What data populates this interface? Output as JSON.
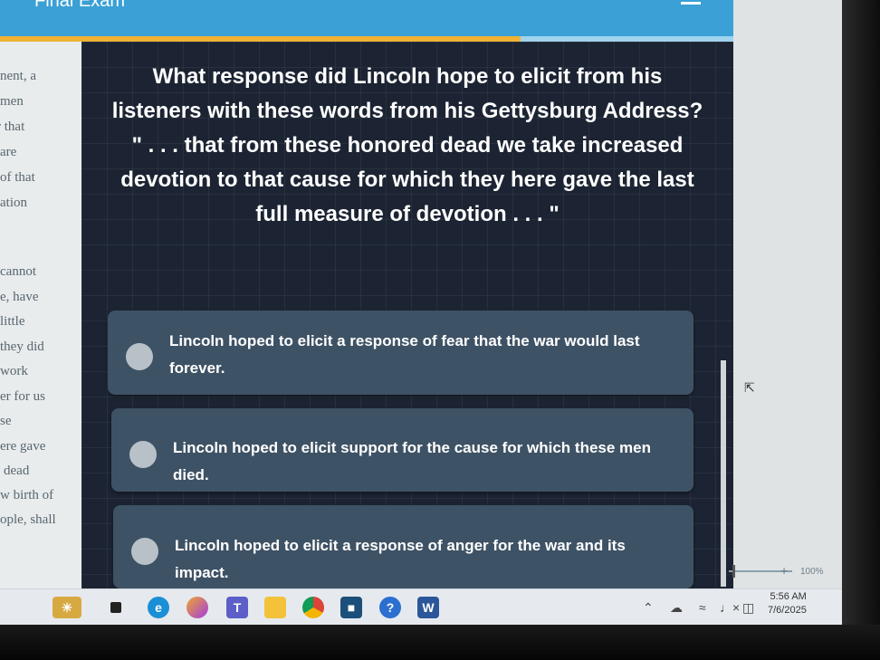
{
  "app": {
    "title": "Final Exam",
    "progress_fraction": 0.71
  },
  "passage": {
    "lines": [
      "nent, a",
      "men",
      "r that",
      "are",
      "of that",
      "ation",
      "",
      "cannot",
      "e, have",
      "little",
      "they did",
      "work",
      "er for us",
      "se",
      "ere gave",
      "dead",
      "w birth of",
      "ople, shall"
    ]
  },
  "question": {
    "lines": [
      "What response did Lincoln hope to elicit from his",
      "listeners with these words from his Gettysburg Address?",
      "\" . . . that from these honored dead we take increased",
      "devotion to that cause for which they here gave the last",
      "full measure of devotion . . . \""
    ]
  },
  "options": [
    {
      "lines": [
        "Lincoln hoped to elicit a response of fear that the war would last",
        "forever."
      ]
    },
    {
      "lines": [
        "Lincoln hoped to elicit support for the cause for which these men died."
      ]
    },
    {
      "lines": [
        "Lincoln hoped to elicit a response of anger for the war and its impact."
      ]
    }
  ],
  "zoom": {
    "label": "100%"
  },
  "taskbar": {
    "icons": [
      "weather-icon",
      "taskview-icon",
      "edge-icon",
      "copilot-icon",
      "teams-icon",
      "file-explorer-icon",
      "chrome-icon",
      "store-icon",
      "help-icon",
      "word-icon"
    ],
    "tray_icons": [
      "chevron-up-icon",
      "cloud-icon",
      "wifi-icon",
      "volume-muted-icon",
      "battery-icon"
    ],
    "time": "5:56 AM",
    "date": "7/6/2025"
  },
  "colors": {
    "header": "#3aa0d6",
    "progress": "#f0b233",
    "panel": "#1c2433",
    "option": "#3e5265"
  }
}
